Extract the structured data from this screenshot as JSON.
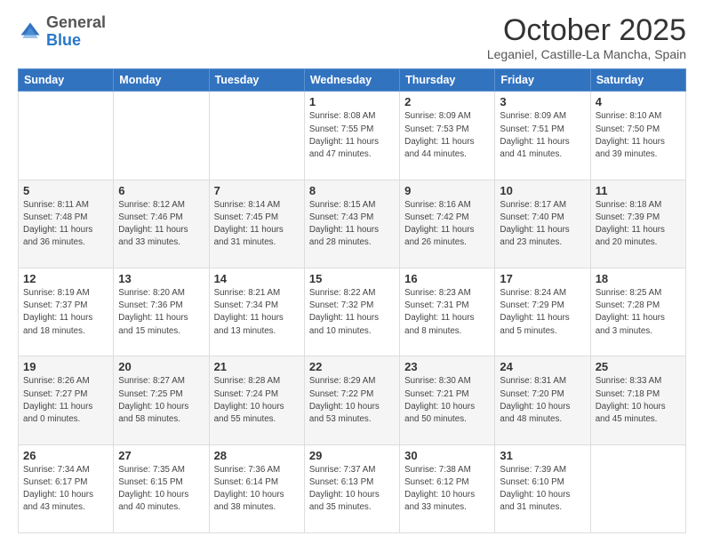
{
  "logo": {
    "general": "General",
    "blue": "Blue"
  },
  "header": {
    "month": "October 2025",
    "location": "Leganiel, Castille-La Mancha, Spain"
  },
  "weekdays": [
    "Sunday",
    "Monday",
    "Tuesday",
    "Wednesday",
    "Thursday",
    "Friday",
    "Saturday"
  ],
  "weeks": [
    [
      {
        "day": "",
        "info": ""
      },
      {
        "day": "",
        "info": ""
      },
      {
        "day": "",
        "info": ""
      },
      {
        "day": "1",
        "info": "Sunrise: 8:08 AM\nSunset: 7:55 PM\nDaylight: 11 hours\nand 47 minutes."
      },
      {
        "day": "2",
        "info": "Sunrise: 8:09 AM\nSunset: 7:53 PM\nDaylight: 11 hours\nand 44 minutes."
      },
      {
        "day": "3",
        "info": "Sunrise: 8:09 AM\nSunset: 7:51 PM\nDaylight: 11 hours\nand 41 minutes."
      },
      {
        "day": "4",
        "info": "Sunrise: 8:10 AM\nSunset: 7:50 PM\nDaylight: 11 hours\nand 39 minutes."
      }
    ],
    [
      {
        "day": "5",
        "info": "Sunrise: 8:11 AM\nSunset: 7:48 PM\nDaylight: 11 hours\nand 36 minutes."
      },
      {
        "day": "6",
        "info": "Sunrise: 8:12 AM\nSunset: 7:46 PM\nDaylight: 11 hours\nand 33 minutes."
      },
      {
        "day": "7",
        "info": "Sunrise: 8:14 AM\nSunset: 7:45 PM\nDaylight: 11 hours\nand 31 minutes."
      },
      {
        "day": "8",
        "info": "Sunrise: 8:15 AM\nSunset: 7:43 PM\nDaylight: 11 hours\nand 28 minutes."
      },
      {
        "day": "9",
        "info": "Sunrise: 8:16 AM\nSunset: 7:42 PM\nDaylight: 11 hours\nand 26 minutes."
      },
      {
        "day": "10",
        "info": "Sunrise: 8:17 AM\nSunset: 7:40 PM\nDaylight: 11 hours\nand 23 minutes."
      },
      {
        "day": "11",
        "info": "Sunrise: 8:18 AM\nSunset: 7:39 PM\nDaylight: 11 hours\nand 20 minutes."
      }
    ],
    [
      {
        "day": "12",
        "info": "Sunrise: 8:19 AM\nSunset: 7:37 PM\nDaylight: 11 hours\nand 18 minutes."
      },
      {
        "day": "13",
        "info": "Sunrise: 8:20 AM\nSunset: 7:36 PM\nDaylight: 11 hours\nand 15 minutes."
      },
      {
        "day": "14",
        "info": "Sunrise: 8:21 AM\nSunset: 7:34 PM\nDaylight: 11 hours\nand 13 minutes."
      },
      {
        "day": "15",
        "info": "Sunrise: 8:22 AM\nSunset: 7:32 PM\nDaylight: 11 hours\nand 10 minutes."
      },
      {
        "day": "16",
        "info": "Sunrise: 8:23 AM\nSunset: 7:31 PM\nDaylight: 11 hours\nand 8 minutes."
      },
      {
        "day": "17",
        "info": "Sunrise: 8:24 AM\nSunset: 7:29 PM\nDaylight: 11 hours\nand 5 minutes."
      },
      {
        "day": "18",
        "info": "Sunrise: 8:25 AM\nSunset: 7:28 PM\nDaylight: 11 hours\nand 3 minutes."
      }
    ],
    [
      {
        "day": "19",
        "info": "Sunrise: 8:26 AM\nSunset: 7:27 PM\nDaylight: 11 hours\nand 0 minutes."
      },
      {
        "day": "20",
        "info": "Sunrise: 8:27 AM\nSunset: 7:25 PM\nDaylight: 10 hours\nand 58 minutes."
      },
      {
        "day": "21",
        "info": "Sunrise: 8:28 AM\nSunset: 7:24 PM\nDaylight: 10 hours\nand 55 minutes."
      },
      {
        "day": "22",
        "info": "Sunrise: 8:29 AM\nSunset: 7:22 PM\nDaylight: 10 hours\nand 53 minutes."
      },
      {
        "day": "23",
        "info": "Sunrise: 8:30 AM\nSunset: 7:21 PM\nDaylight: 10 hours\nand 50 minutes."
      },
      {
        "day": "24",
        "info": "Sunrise: 8:31 AM\nSunset: 7:20 PM\nDaylight: 10 hours\nand 48 minutes."
      },
      {
        "day": "25",
        "info": "Sunrise: 8:33 AM\nSunset: 7:18 PM\nDaylight: 10 hours\nand 45 minutes."
      }
    ],
    [
      {
        "day": "26",
        "info": "Sunrise: 7:34 AM\nSunset: 6:17 PM\nDaylight: 10 hours\nand 43 minutes."
      },
      {
        "day": "27",
        "info": "Sunrise: 7:35 AM\nSunset: 6:15 PM\nDaylight: 10 hours\nand 40 minutes."
      },
      {
        "day": "28",
        "info": "Sunrise: 7:36 AM\nSunset: 6:14 PM\nDaylight: 10 hours\nand 38 minutes."
      },
      {
        "day": "29",
        "info": "Sunrise: 7:37 AM\nSunset: 6:13 PM\nDaylight: 10 hours\nand 35 minutes."
      },
      {
        "day": "30",
        "info": "Sunrise: 7:38 AM\nSunset: 6:12 PM\nDaylight: 10 hours\nand 33 minutes."
      },
      {
        "day": "31",
        "info": "Sunrise: 7:39 AM\nSunset: 6:10 PM\nDaylight: 10 hours\nand 31 minutes."
      },
      {
        "day": "",
        "info": ""
      }
    ]
  ]
}
